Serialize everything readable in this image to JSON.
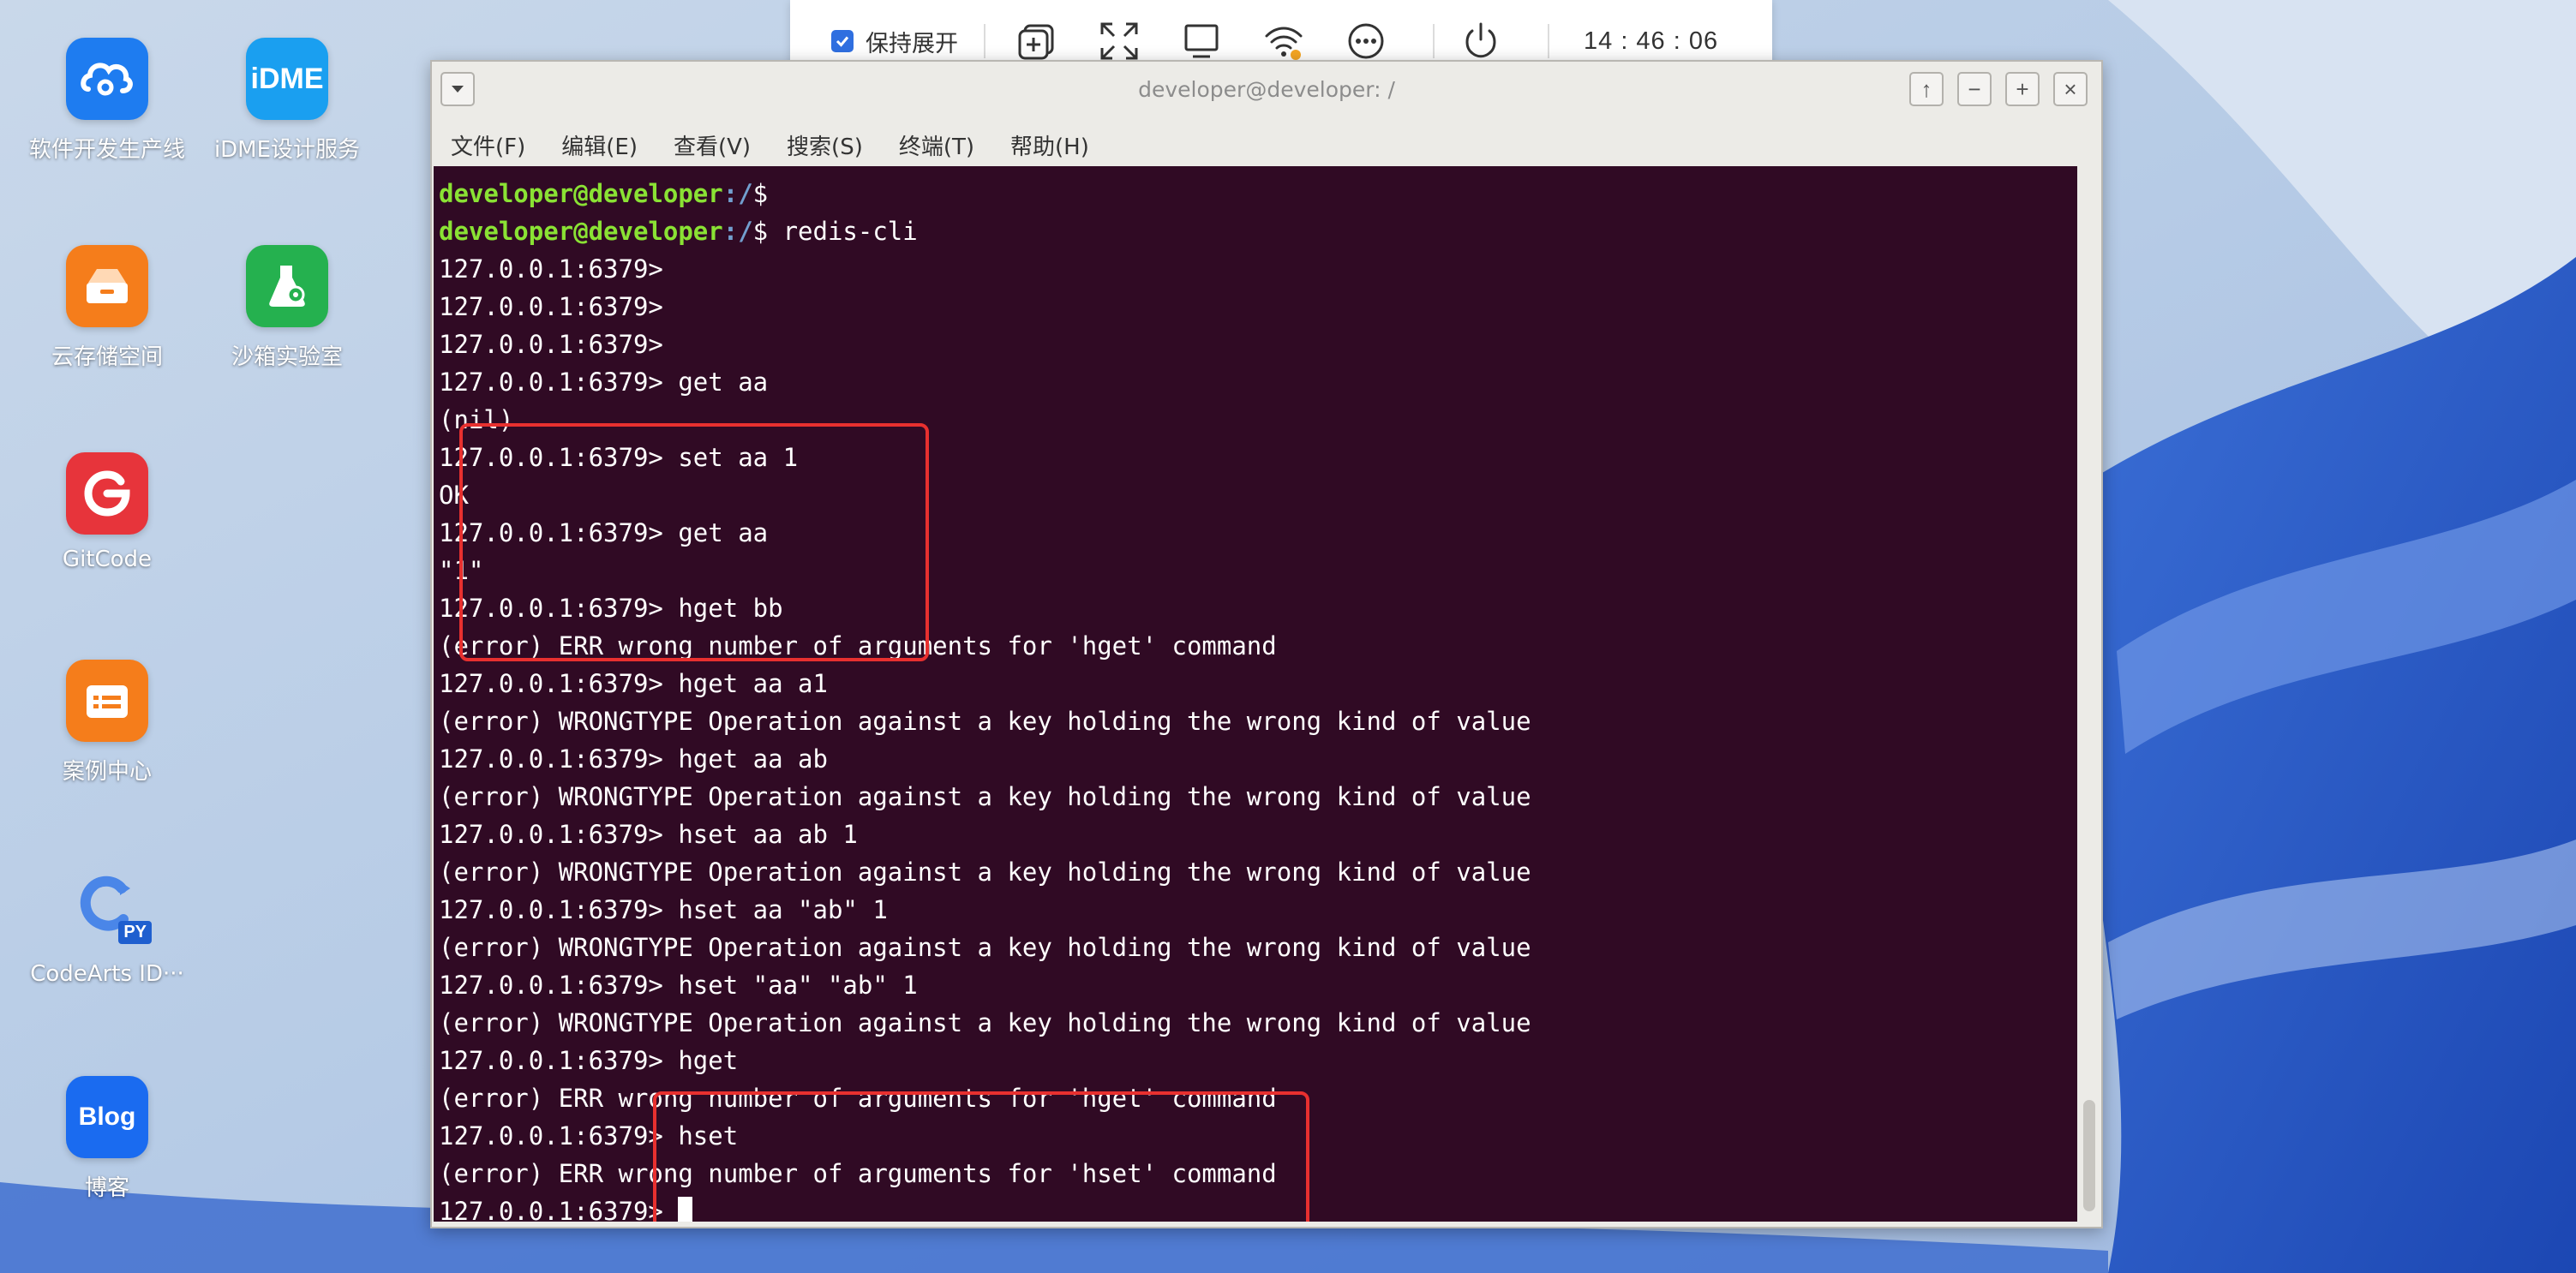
{
  "desktop": {
    "icons": [
      {
        "label": "软件开发生产线",
        "icon": "cloud-swirl-icon",
        "color": "#1e7cf0"
      },
      {
        "label": "iDME设计服务",
        "icon": "idme-logo-icon",
        "color": "#1a9ff0"
      },
      {
        "label": "云存储空间",
        "icon": "storage-box-icon",
        "color": "#f57d1b"
      },
      {
        "label": "沙箱实验室",
        "icon": "flask-gear-icon",
        "color": "#25b14f"
      },
      {
        "label": "GitCode",
        "icon": "gitcode-logo-icon",
        "color": "#e7343b"
      },
      {
        "label": "案例中心",
        "icon": "case-folder-icon",
        "color": "#f57d1b"
      },
      {
        "label": "CodeArts ID···",
        "icon": "codearts-py-icon",
        "color": "#2a6fdb"
      },
      {
        "label": "博客",
        "icon": "blog-logo-icon",
        "color": "#1a6bf0"
      }
    ],
    "codearts_badge": "PY",
    "blog_logo_text": "Blog",
    "idme_logo_text": "iDME"
  },
  "toolbar": {
    "keep_expanded_label": "保持展开",
    "keep_expanded_checked": true,
    "buttons": [
      "add-window-icon",
      "fullscreen-icon",
      "display-icon",
      "wifi-icon",
      "more-icon",
      "power-icon"
    ],
    "clock": "14 : 46 : 06"
  },
  "window": {
    "title": "developer@developer: /",
    "menu": [
      "文件(F)",
      "编辑(E)",
      "查看(V)",
      "搜索(S)",
      "终端(T)",
      "帮助(H)"
    ],
    "controls": {
      "up": "↑",
      "minimize": "−",
      "maximize": "+",
      "close": "×"
    }
  },
  "terminal": {
    "colors": {
      "background": "#300a24",
      "prompt_user": "#8ae234",
      "prompt_path": "#729fcf",
      "highlight": "#e8302f"
    },
    "prompt_user": "developer@developer",
    "prompt_path": ":/",
    "lines": [
      {
        "kind": "shell",
        "cmd": ""
      },
      {
        "kind": "shell",
        "cmd": " redis-cli"
      },
      {
        "kind": "text",
        "text": "127.0.0.1:6379>"
      },
      {
        "kind": "text",
        "text": "127.0.0.1:6379>"
      },
      {
        "kind": "text",
        "text": "127.0.0.1:6379>"
      },
      {
        "kind": "text",
        "text": "127.0.0.1:6379> get aa"
      },
      {
        "kind": "text",
        "text": "(nil)"
      },
      {
        "kind": "text",
        "text": "127.0.0.1:6379> set aa 1"
      },
      {
        "kind": "text",
        "text": "OK"
      },
      {
        "kind": "text",
        "text": "127.0.0.1:6379> get aa"
      },
      {
        "kind": "text",
        "text": "\"1\""
      },
      {
        "kind": "text",
        "text": "127.0.0.1:6379> hget bb"
      },
      {
        "kind": "text",
        "text": "(error) ERR wrong number of arguments for 'hget' command"
      },
      {
        "kind": "text",
        "text": "127.0.0.1:6379> hget aa a1"
      },
      {
        "kind": "text",
        "text": "(error) WRONGTYPE Operation against a key holding the wrong kind of value"
      },
      {
        "kind": "text",
        "text": "127.0.0.1:6379> hget aa ab"
      },
      {
        "kind": "text",
        "text": "(error) WRONGTYPE Operation against a key holding the wrong kind of value"
      },
      {
        "kind": "text",
        "text": "127.0.0.1:6379> hset aa ab 1"
      },
      {
        "kind": "text",
        "text": "(error) WRONGTYPE Operation against a key holding the wrong kind of value"
      },
      {
        "kind": "text",
        "text": "127.0.0.1:6379> hset aa \"ab\" 1"
      },
      {
        "kind": "text",
        "text": "(error) WRONGTYPE Operation against a key holding the wrong kind of value"
      },
      {
        "kind": "text",
        "text": "127.0.0.1:6379> hset \"aa\" \"ab\" 1"
      },
      {
        "kind": "text",
        "text": "(error) WRONGTYPE Operation against a key holding the wrong kind of value"
      },
      {
        "kind": "text",
        "text": "127.0.0.1:6379> hget"
      },
      {
        "kind": "text",
        "text": "(error) ERR wrong number of arguments for 'hget' command"
      },
      {
        "kind": "text",
        "text": "127.0.0.1:6379> hset"
      },
      {
        "kind": "text",
        "text": "(error) ERR wrong number of arguments for 'hset' command"
      },
      {
        "kind": "cursor",
        "text": "127.0.0.1:6379> "
      }
    ]
  }
}
